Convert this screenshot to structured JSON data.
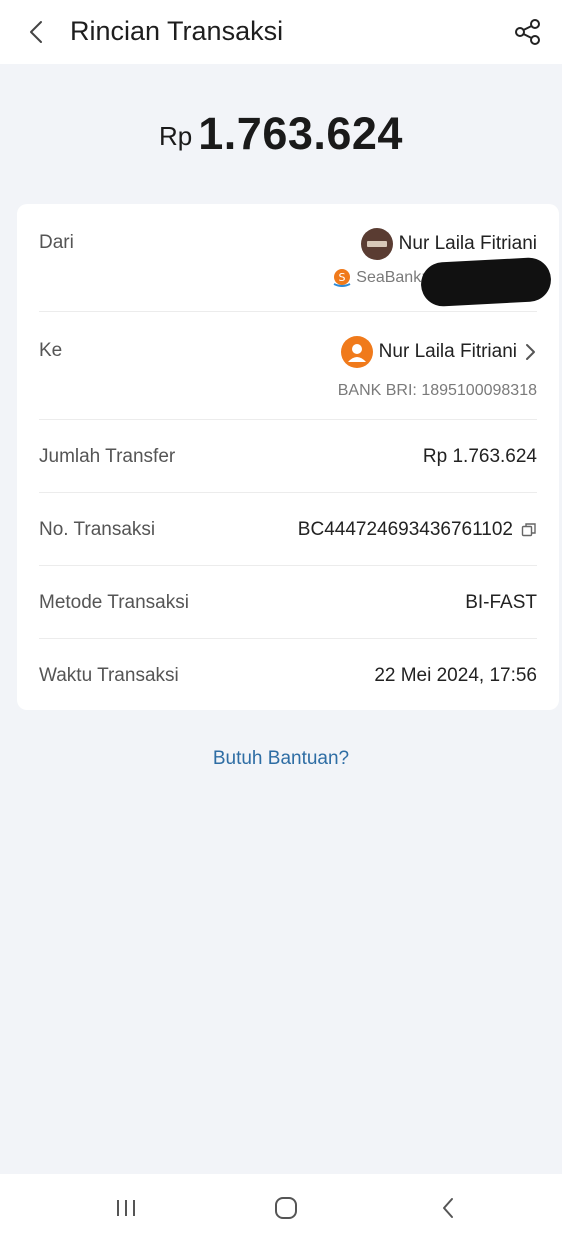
{
  "header": {
    "title": "Rincian Transaksi",
    "back_icon": "chevron-left-icon",
    "share_icon": "share-icon"
  },
  "amount": {
    "currency": "Rp",
    "value": "1.763.624"
  },
  "from": {
    "label": "Dari",
    "name": "Nur Laila Fitriani",
    "bank": "SeaBank: 9"
  },
  "to": {
    "label": "Ke",
    "name": "Nur Laila Fitriani",
    "bank": "BANK BRI: 1895100098318"
  },
  "details": [
    {
      "label": "Jumlah Transfer",
      "value": "Rp 1.763.624"
    },
    {
      "label": "No. Transaksi",
      "value": "BC444724693436761102"
    },
    {
      "label": "Metode Transaksi",
      "value": "BI-FAST"
    },
    {
      "label": "Waktu Transaksi",
      "value": "22 Mei 2024, 17:56"
    }
  ],
  "help_link": "Butuh Bantuan?",
  "colors": {
    "background": "#f2f4f8",
    "link": "#2e6da4",
    "avatar_orange": "#f07a1b",
    "seabank_orange": "#f07a1b"
  }
}
